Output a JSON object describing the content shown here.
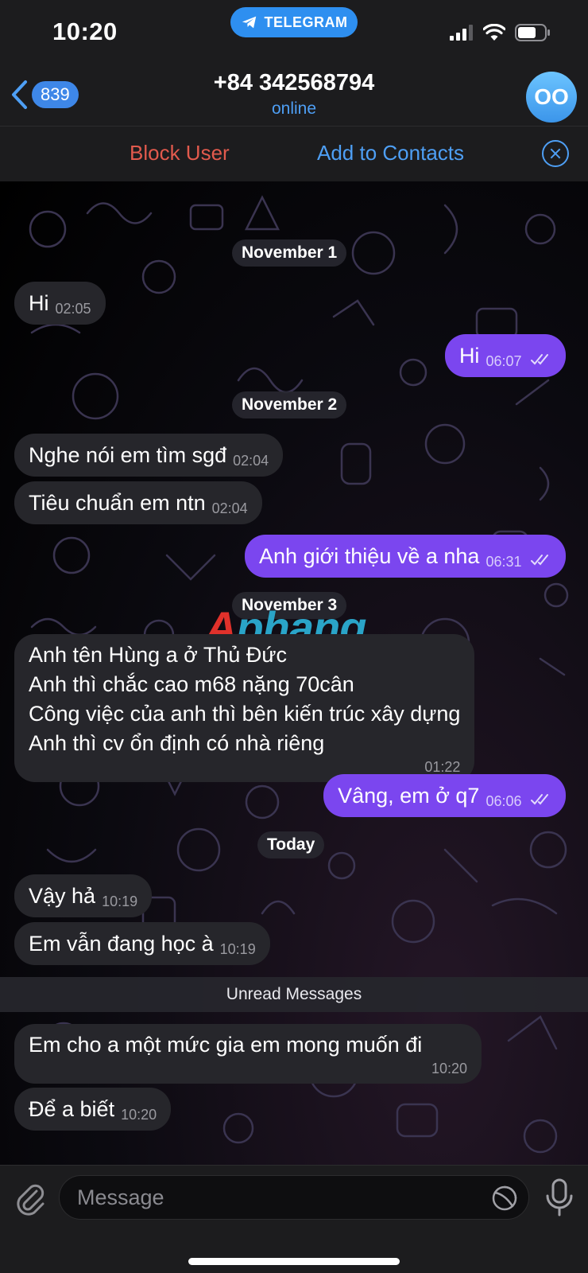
{
  "status_bar": {
    "time": "10:20",
    "app_pill": "TELEGRAM"
  },
  "header": {
    "back_count": "839",
    "title": "+84 342568794",
    "status": "online",
    "avatar_initials": "OO"
  },
  "actions": {
    "block": "Block User",
    "add": "Add to Contacts"
  },
  "dates": {
    "d1": "November 1",
    "d2": "November 2",
    "d3": "November 3",
    "d4": "Today"
  },
  "messages": [
    {
      "text": "Hi",
      "time": "02:05",
      "dir": "in"
    },
    {
      "text": "Hi",
      "time": "06:07",
      "dir": "out"
    },
    {
      "text": "Nghe nói em tìm sgđ",
      "time": "02:04",
      "dir": "in"
    },
    {
      "text": "Tiêu chuẩn em ntn",
      "time": "02:04",
      "dir": "in"
    },
    {
      "text": "Anh giới thiệu về a nha",
      "time": "06:31",
      "dir": "out"
    },
    {
      "lines": [
        "Anh tên Hùng a ở Thủ Đức",
        "Anh thì chắc cao m68 nặng 70cân",
        "Công việc của anh thì bên kiến trúc xây dựng",
        "Anh thì cv ổn định có nhà riêng"
      ],
      "time": "01:22",
      "dir": "in"
    },
    {
      "text": "Vâng, em ở q7",
      "time": "06:06",
      "dir": "out"
    },
    {
      "text": "Vậy hả",
      "time": "10:19",
      "dir": "in"
    },
    {
      "text": "Em vẫn đang học à",
      "time": "10:19",
      "dir": "in"
    },
    {
      "text": "Em cho a một mức gia em mong muốn đi",
      "time": "10:20",
      "dir": "in"
    },
    {
      "text": "Để a biết",
      "time": "10:20",
      "dir": "in"
    }
  ],
  "unread_label": "Unread Messages",
  "watermark": {
    "part1": "A",
    "part2": "phang"
  },
  "composer": {
    "placeholder": "Message"
  },
  "colors": {
    "accent": "#4e9ff5",
    "outgoing": "#7b46ef",
    "danger": "#e25a4d"
  },
  "icons": [
    "telegram-icon",
    "signal-icon",
    "wifi-icon",
    "battery-icon",
    "back-chevron-icon",
    "close-icon",
    "attach-icon",
    "sticker-icon",
    "microphone-icon",
    "double-check-icon"
  ]
}
